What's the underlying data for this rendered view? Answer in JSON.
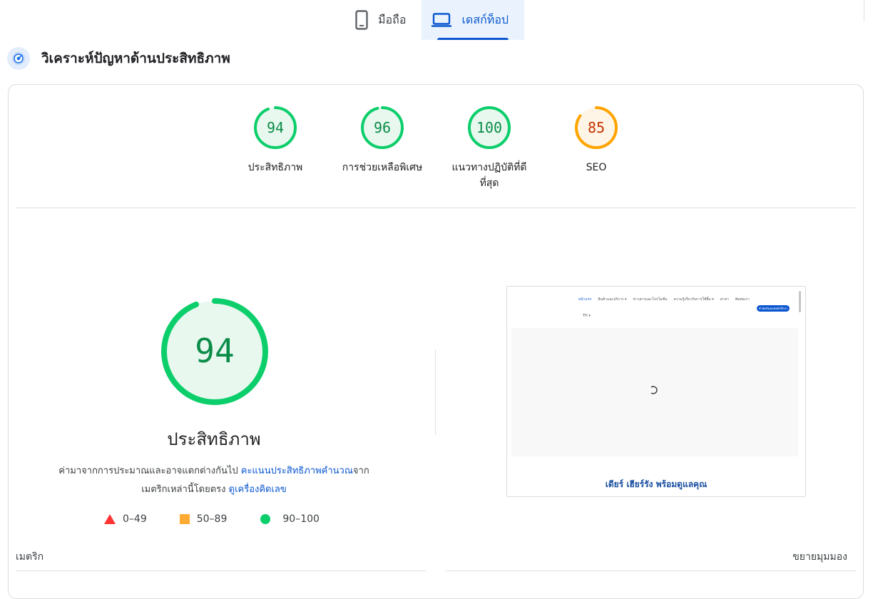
{
  "tabs": [
    {
      "label": "มือถือ",
      "icon": "mobile-icon",
      "active": false
    },
    {
      "label": "เดสก์ท็อป",
      "icon": "desktop-icon",
      "active": true
    }
  ],
  "section": {
    "title": "วิเคราะห์ปัญหาด้านประสิทธิภาพ",
    "icon": "performance-icon"
  },
  "gauges": [
    {
      "score": "94",
      "label": "ประสิทธิภาพ",
      "color": "#0cce6b",
      "text_color": "#0a8c47",
      "fill": "#e8f8ef",
      "fraction": 0.94
    },
    {
      "score": "96",
      "label": "การช่วยเหลือพิเศษ",
      "color": "#0cce6b",
      "text_color": "#0a8c47",
      "fill": "#e8f8ef",
      "fraction": 0.96
    },
    {
      "score": "100",
      "label": "แนวทางปฏิบัติที่ดีที่สุด",
      "color": "#0cce6b",
      "text_color": "#0a8c47",
      "fill": "#e8f8ef",
      "fraction": 1.0
    },
    {
      "score": "85",
      "label": "SEO",
      "color": "#ffa400",
      "text_color": "#c33300",
      "fill": "#fff5e6",
      "fraction": 0.85
    }
  ],
  "main": {
    "score": "94",
    "fraction": 0.94,
    "title": "ประสิทธิภาพ",
    "desc_prefix": "ค่ามาจากการประมาณและอาจแตกต่างกันไป ",
    "desc_link1": "คะแนนประสิทธิภาพคำนวณ",
    "desc_mid": "จาก",
    "desc_line2": "เมตริกเหล่านี้โดยตรง ",
    "desc_link2": "ดูเครื่องคิดเลข"
  },
  "legend": [
    {
      "range": "0–49",
      "shape": "triangle",
      "color": "#ff3333"
    },
    {
      "range": "50–89",
      "shape": "square",
      "color": "#ffaa33"
    },
    {
      "range": "90–100",
      "shape": "circle",
      "color": "#0cce6b"
    }
  ],
  "screenshot": {
    "nav": [
      "หน้าแรก",
      "สินค้าและบริการ ▾",
      "ข่าวสารและโปรโมชั่น",
      "ความรู้เกี่ยวกับการใช้ยิ้ม ▾",
      "สาขา",
      "ติดต่อเรา"
    ],
    "button": "ทำนัดทันตแพทย์ปรึกษา",
    "lang": "TH ▾",
    "tagline": "เดียร์ เฮียร์รัง พร้อมดูแลคุณ"
  },
  "footer": {
    "metrics": "เมตริก",
    "expand": "ขยายมุมมอง"
  }
}
